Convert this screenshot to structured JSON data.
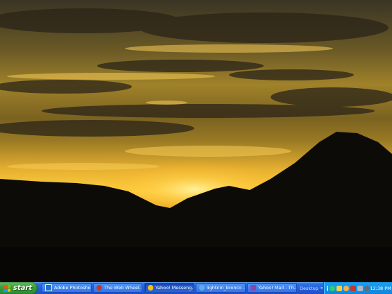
{
  "taskbar": {
    "start_label": "start",
    "tasks": [
      {
        "label": "Adobe Photoshop",
        "icon": "photoshop-icon",
        "color": "#1f6fd0"
      },
      {
        "label": "The Web Wheel...",
        "icon": "web-wheel-icon",
        "color": "#c0392b"
      },
      {
        "label": "Yahoo! Messeng...",
        "icon": "messenger-icon",
        "color": "#f1c40f"
      },
      {
        "label": "lightnin_bronco ...",
        "icon": "ie-icon",
        "color": "#5dade2"
      },
      {
        "label": "Yahoo! Mail - Th...",
        "icon": "yahoo-mail-icon",
        "color": "#8e44ad"
      }
    ],
    "desktop_label": "Desktop",
    "clock": "12:38 PM"
  }
}
